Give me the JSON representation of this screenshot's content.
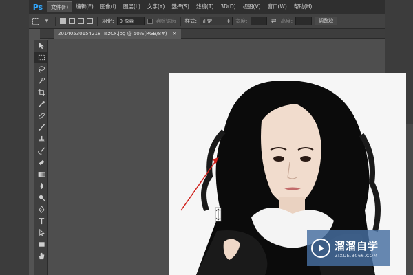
{
  "app": {
    "logo": "Ps"
  },
  "menu": {
    "items": [
      "文件(F)",
      "编辑(E)",
      "图像(I)",
      "图层(L)",
      "文字(Y)",
      "选择(S)",
      "滤镜(T)",
      "3D(D)",
      "视图(V)",
      "窗口(W)",
      "帮助(H)"
    ],
    "active_index": 0
  },
  "options": {
    "feather_label": "羽化:",
    "feather_value": "0 像素",
    "antialias_label": "消除锯齿",
    "style_label": "样式:",
    "style_value": "正常",
    "width_label": "宽度:",
    "height_label": "高度:",
    "adjust_edge_label": "调整边"
  },
  "document": {
    "tab_title": "20140530154218_TszCx.jpg @ 50%(RGB/8#)",
    "close_glyph": "×"
  },
  "tools": [
    "move-tool-icon",
    "marquee-tool-icon",
    "lasso-tool-icon",
    "quick-select-tool-icon",
    "crop-tool-icon",
    "eyedropper-tool-icon",
    "healing-brush-tool-icon",
    "brush-tool-icon",
    "clone-stamp-tool-icon",
    "history-brush-tool-icon",
    "eraser-tool-icon",
    "gradient-tool-icon",
    "blur-tool-icon",
    "dodge-tool-icon",
    "pen-tool-icon",
    "type-tool-icon",
    "path-select-tool-icon",
    "rectangle-tool-icon",
    "hand-tool-icon"
  ],
  "selected_tool_index": 1,
  "watermark": {
    "title": "溜溜自学",
    "url": "ZIXUE.3066.COM"
  },
  "colors": {
    "ps_blue": "#31a8ff",
    "arrow_red": "#d0211c",
    "watermark_bg": "#466ea0"
  }
}
